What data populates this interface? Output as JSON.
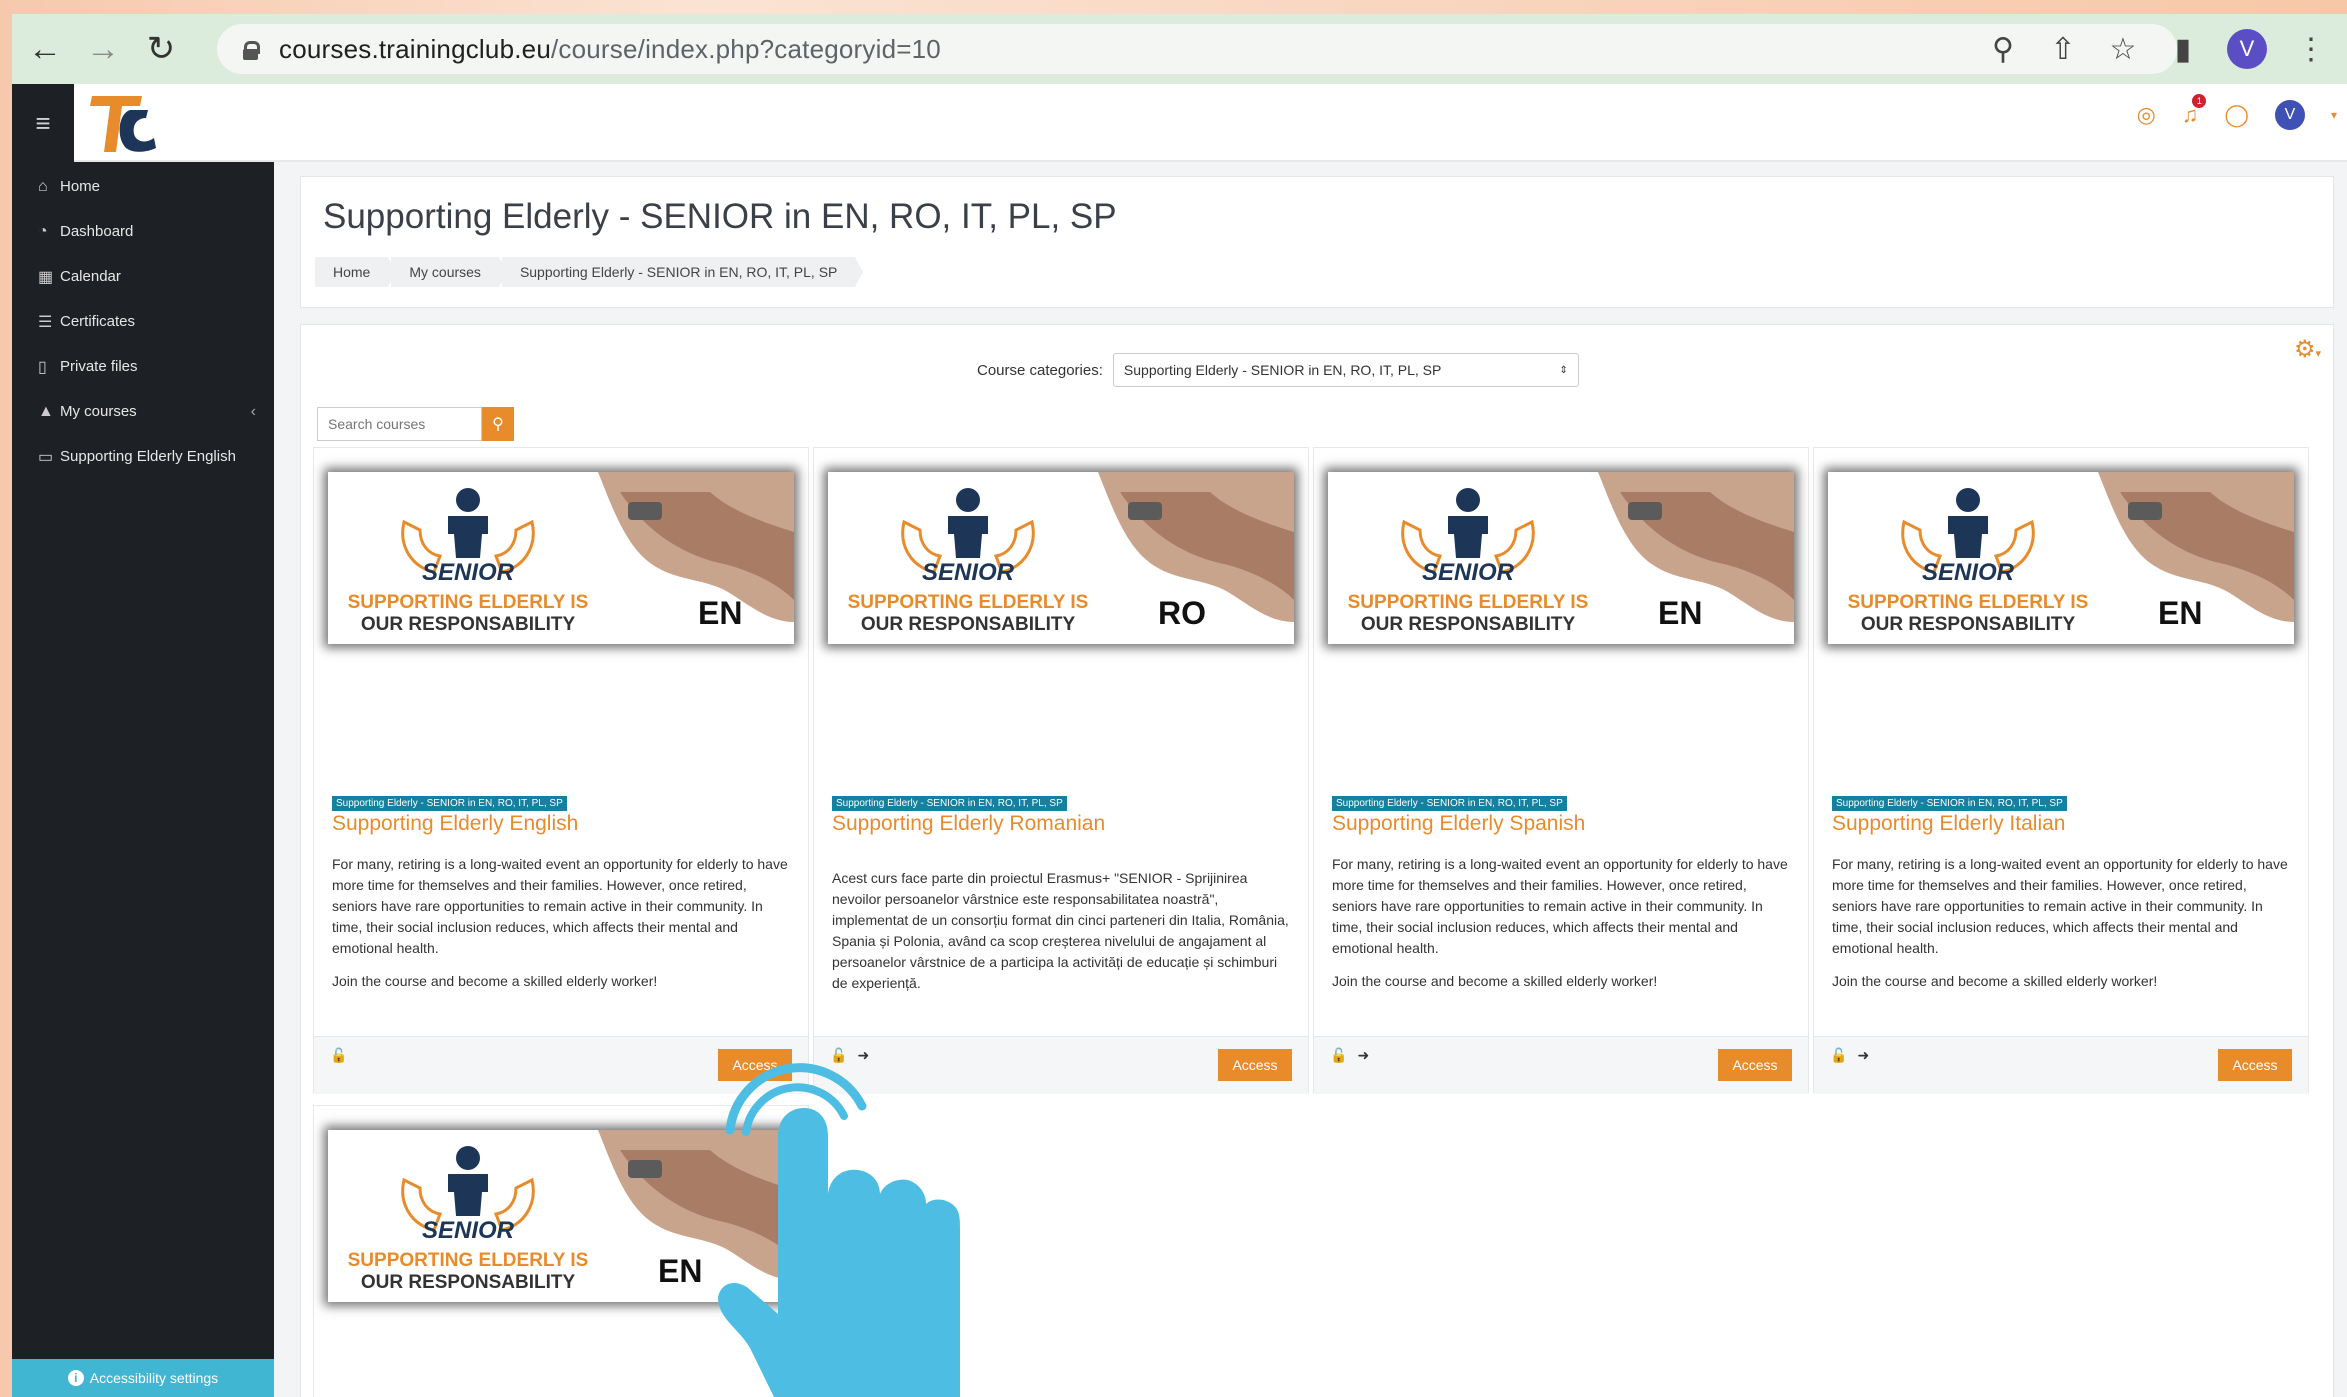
{
  "browser": {
    "url_domain": "courses.trainingclub.eu",
    "url_path": "/course/index.php?categoryid=10",
    "profile_initial": "V"
  },
  "topbar": {
    "notification_count": "1",
    "user_initial": "V"
  },
  "sidebar": {
    "items": [
      {
        "label": "Home",
        "icon": "home-icon"
      },
      {
        "label": "Dashboard",
        "icon": "gauge-icon"
      },
      {
        "label": "Calendar",
        "icon": "calendar-icon"
      },
      {
        "label": "Certificates",
        "icon": "layers-icon"
      },
      {
        "label": "Private files",
        "icon": "file-icon"
      },
      {
        "label": "My courses",
        "icon": "graduation-cap-icon"
      },
      {
        "label": "Supporting Elderly English",
        "icon": "folder-icon"
      }
    ],
    "accessibility_label": "Accessibility settings"
  },
  "page": {
    "title": "Supporting Elderly - SENIOR in EN, RO, IT, PL, SP",
    "breadcrumb": [
      "Home",
      "My courses",
      "Supporting Elderly - SENIOR in EN, RO, IT, PL, SP"
    ]
  },
  "filters": {
    "category_label": "Course categories:",
    "category_value": "Supporting Elderly - SENIOR in EN, RO, IT, PL, SP",
    "search_placeholder": "Search courses"
  },
  "course_image": {
    "brand": "SENIOR",
    "slogan_line1": "SUPPORTING ELDERLY IS",
    "slogan_line2": "OUR RESPONSABILITY"
  },
  "courses": [
    {
      "lang": "EN",
      "category": "Supporting Elderly - SENIOR in EN, RO, IT, PL, SP",
      "title": "Supporting Elderly English",
      "desc1": "For many, retiring is a long-waited event an opportunity for elderly to have more time for themselves and their families. However, once retired, seniors have rare opportunities to remain active in their community. In time, their social inclusion reduces, which affects their mental and emotional health.",
      "desc2": "Join the course and become a skilled elderly worker!",
      "access_label": "Access"
    },
    {
      "lang": "RO",
      "category": "Supporting Elderly - SENIOR in EN, RO, IT, PL, SP",
      "title": "Supporting Elderly Romanian",
      "desc1": "Acest curs face parte din proiectul Erasmus+ \"SENIOR - Sprijinirea nevoilor persoanelor vârstnice este responsabilitatea noastră\", implementat de un consorțiu format din cinci parteneri din Italia, România, Spania și Polonia, având ca scop creșterea nivelului de angajament al persoanelor vârstnice de a participa la activități de educație și schimburi de experiență.",
      "desc2": "",
      "access_label": "Access"
    },
    {
      "lang": "EN",
      "category": "Supporting Elderly - SENIOR in EN, RO, IT, PL, SP",
      "title": "Supporting Elderly Spanish",
      "desc1": "For many, retiring is a long-waited event an opportunity for elderly to have more time for themselves and their families. However, once retired, seniors have rare opportunities to remain active in their community. In time, their social inclusion reduces, which affects their mental and emotional health.",
      "desc2": "Join the course and become a skilled elderly worker!",
      "access_label": "Access"
    },
    {
      "lang": "EN",
      "category": "Supporting Elderly - SENIOR in EN, RO, IT, PL, SP",
      "title": "Supporting Elderly Italian",
      "desc1": "For many, retiring is a long-waited event an opportunity for elderly to have more time for themselves and their families. However, once retired, seniors have rare opportunities to remain active in their community. In time, their social inclusion reduces, which affects their mental and emotional health.",
      "desc2": "Join the course and become a skilled elderly worker!",
      "access_label": "Access"
    },
    {
      "lang": "EN"
    }
  ],
  "colors": {
    "accent": "#e88b2b",
    "sidebar_bg": "#1d2125",
    "badge": "#1580a0",
    "pointer_hand": "#4dbde4"
  }
}
